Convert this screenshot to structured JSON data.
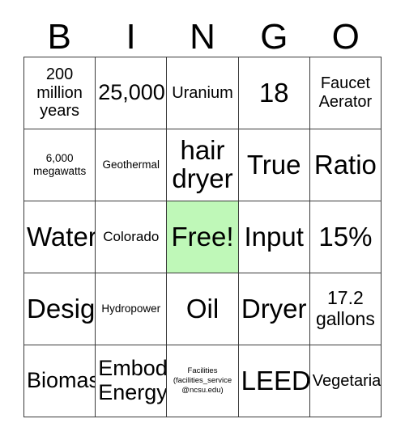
{
  "card": {
    "title_letters": [
      "B",
      "I",
      "N",
      "G",
      "O"
    ],
    "free_space_color": "#bff8b8",
    "border_color": "#3a3a3a",
    "background_color": "#ffffff",
    "text_color": "#000000",
    "rows": 5,
    "columns": 5
  },
  "squares": [
    {
      "text": "200\nmillion\nyears",
      "size": "md",
      "free": false
    },
    {
      "text": "25,000",
      "size": "xl",
      "free": false
    },
    {
      "text": "Uranium",
      "size": "md",
      "free": false
    },
    {
      "text": "18",
      "size": "xxl",
      "free": false
    },
    {
      "text": "Faucet\nAerator",
      "size": "md",
      "free": false
    },
    {
      "text": "6,000\nmegawatts",
      "size": "xs",
      "free": false
    },
    {
      "text": "Geothermal",
      "size": "xs",
      "free": false
    },
    {
      "text": "hair\ndryer",
      "size": "xxl",
      "free": false
    },
    {
      "text": "True",
      "size": "xxl",
      "free": false
    },
    {
      "text": "Ratio",
      "size": "xxl",
      "free": false
    },
    {
      "text": "Water",
      "size": "xxl",
      "free": false
    },
    {
      "text": "Colorado",
      "size": "sm",
      "free": false
    },
    {
      "text": "Free!",
      "size": "xxl",
      "free": true
    },
    {
      "text": "Input",
      "size": "xxl",
      "free": false
    },
    {
      "text": "15%",
      "size": "xxl",
      "free": false
    },
    {
      "text": "Design",
      "size": "xxl",
      "free": false
    },
    {
      "text": "Hydropower",
      "size": "xs",
      "free": false
    },
    {
      "text": "Oil",
      "size": "xxl",
      "free": false
    },
    {
      "text": "Dryer",
      "size": "xxl",
      "free": false
    },
    {
      "text": "17.2\ngallons",
      "size": "lg",
      "free": false
    },
    {
      "text": "Biomass",
      "size": "xl",
      "free": false
    },
    {
      "text": "Embodied\nEnergy",
      "size": "xl",
      "free": false
    },
    {
      "text": "Facilities\n(facilities_service\n@ncsu.edu)",
      "size": "xxs",
      "free": false
    },
    {
      "text": "LEED",
      "size": "xxl",
      "free": false
    },
    {
      "text": "Vegetarian",
      "size": "md",
      "free": false
    }
  ]
}
